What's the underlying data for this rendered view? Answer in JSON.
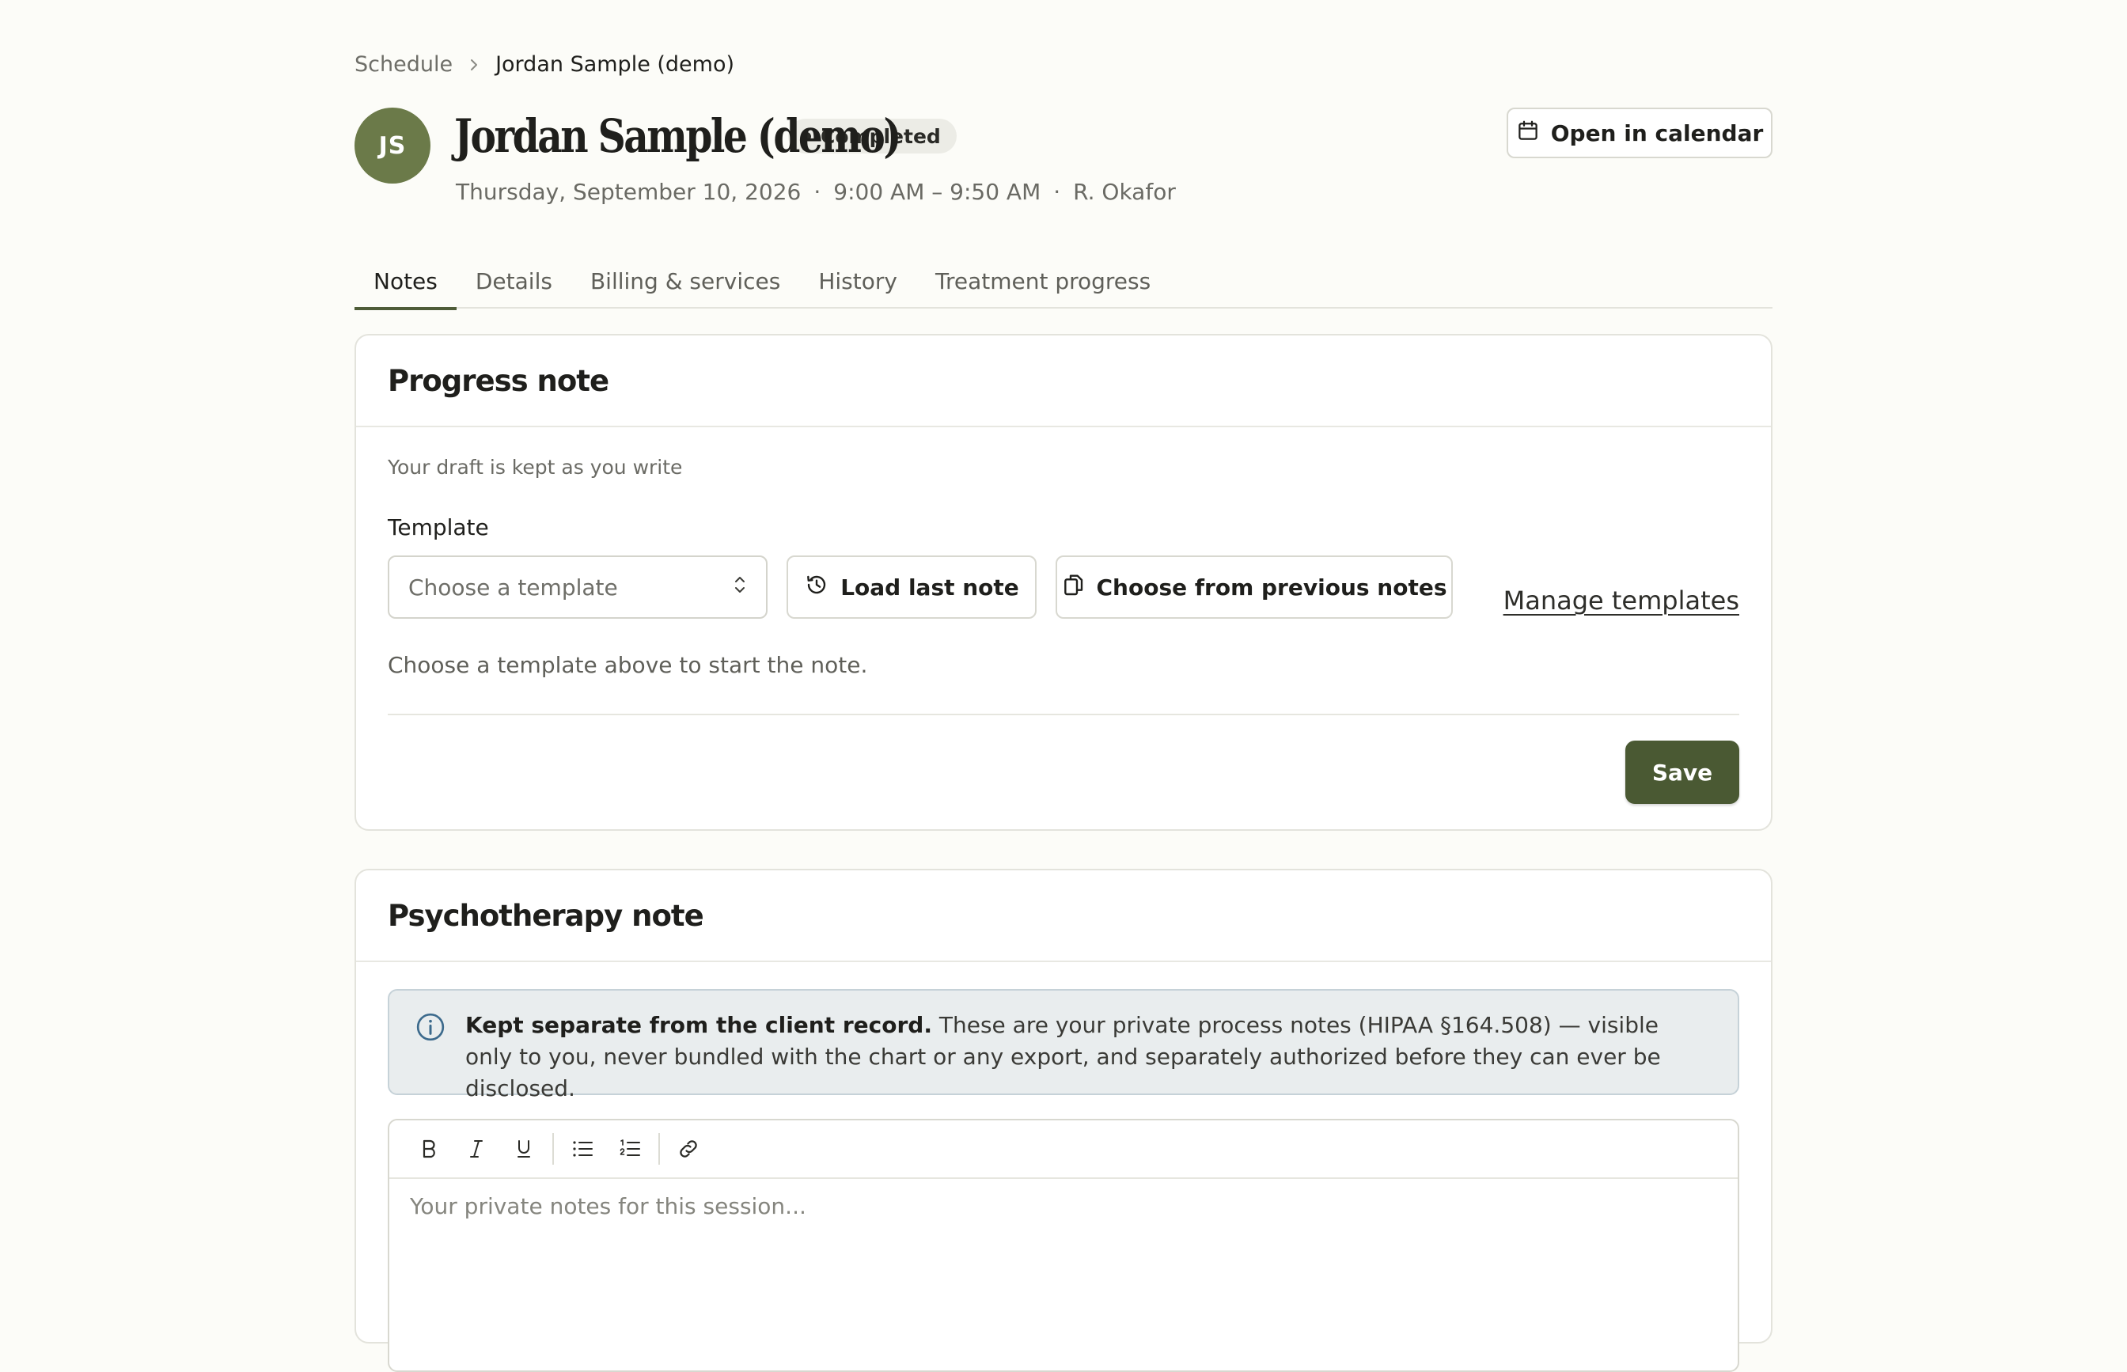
{
  "breadcrumb": {
    "parent": "Schedule",
    "current": "Jordan Sample (demo)"
  },
  "header": {
    "initials": "JS",
    "client_name": "Jordan Sample (demo)",
    "status": "Completed",
    "date": "Thursday, September 10, 2026",
    "time": "9:00 AM – 9:50 AM",
    "clinician": "R. Okafor",
    "open_calendar_label": "Open in calendar"
  },
  "tabs": [
    {
      "label": "Notes",
      "active": true
    },
    {
      "label": "Details",
      "active": false
    },
    {
      "label": "Billing & services",
      "active": false
    },
    {
      "label": "History",
      "active": false
    },
    {
      "label": "Treatment progress",
      "active": false
    }
  ],
  "progress_note": {
    "title": "Progress note",
    "draft_hint": "Your draft is kept as you write",
    "template_label": "Template",
    "template_placeholder": "Choose a template",
    "load_last_label": "Load last note",
    "choose_previous_label": "Choose from previous notes",
    "manage_templates_label": "Manage templates",
    "empty_message": "Choose a template above to start the note.",
    "save_label": "Save"
  },
  "psychotherapy_note": {
    "title": "Psychotherapy note",
    "info_strong": "Kept separate from the client record.",
    "info_text": " These are your private process notes (HIPAA §164.508) — visible only to you, never bundled with the chart or any export, and separately authorized before they can ever be disclosed.",
    "editor_placeholder": "Your private notes for this session..."
  },
  "colors": {
    "accent": "#4a5933",
    "avatar": "#6b7a49",
    "background": "#fcfcf8",
    "info_background": "#e9edee"
  }
}
